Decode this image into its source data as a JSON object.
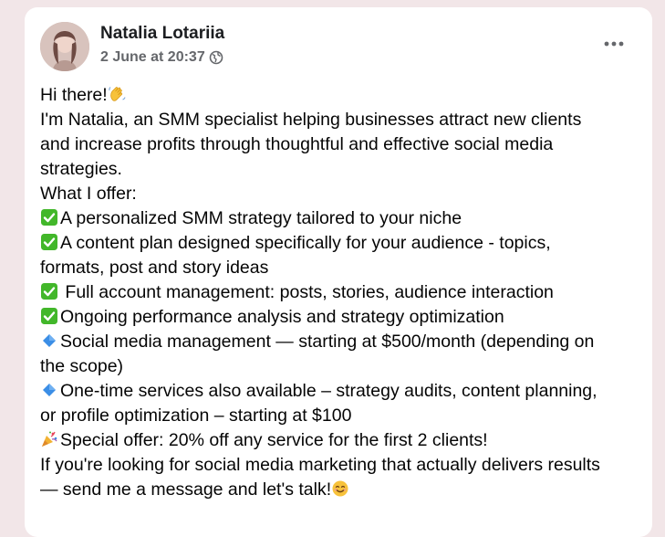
{
  "post": {
    "author": "Natalia Lotariia",
    "timestamp": "2 June at 20:37",
    "privacy_icon": "globe-icon",
    "more_icon": "more-horizontal-icon",
    "lines": [
      {
        "icon": null,
        "text": "Hi there!",
        "trail_icon": "waving-hand-icon"
      },
      {
        "icon": null,
        "text": "I'm Natalia, an SMM specialist helping businesses attract new clients"
      },
      {
        "icon": null,
        "text": "and increase profits through thoughtful and effective social media"
      },
      {
        "icon": null,
        "text": "strategies."
      },
      {
        "icon": null,
        "text": "What I offer:"
      },
      {
        "icon": "check-mark-icon",
        "text": "A personalized SMM strategy tailored to your niche"
      },
      {
        "icon": "check-mark-icon",
        "text": "A content plan designed specifically for your audience - topics,"
      },
      {
        "icon": null,
        "text": "formats, post and story ideas"
      },
      {
        "icon": "check-mark-icon",
        "text": " Full account management: posts, stories, audience interaction"
      },
      {
        "icon": "check-mark-icon",
        "text": "Ongoing performance analysis and strategy optimization"
      },
      {
        "icon": "blue-diamond-icon",
        "text": "Social media management — starting at $500/month (depending on"
      },
      {
        "icon": null,
        "text": "the scope)"
      },
      {
        "icon": "blue-diamond-icon",
        "text": "One-time services also available – strategy audits, content planning,"
      },
      {
        "icon": null,
        "text": "or profile optimization – starting at $100"
      },
      {
        "icon": "party-popper-icon",
        "text": "Special offer: 20% off any service for the first 2 clients!"
      },
      {
        "icon": null,
        "text": "If you're looking for social media marketing that actually delivers results"
      },
      {
        "icon": null,
        "text": "— send me a message and let's talk!",
        "trail_icon": "smiling-face-icon"
      }
    ]
  },
  "colors": {
    "page_bg": "#f2e6e8",
    "card_bg": "#ffffff",
    "meta_text": "#65676b",
    "check_green": "#42b72a",
    "diamond_blue": "#3b8ee6"
  }
}
